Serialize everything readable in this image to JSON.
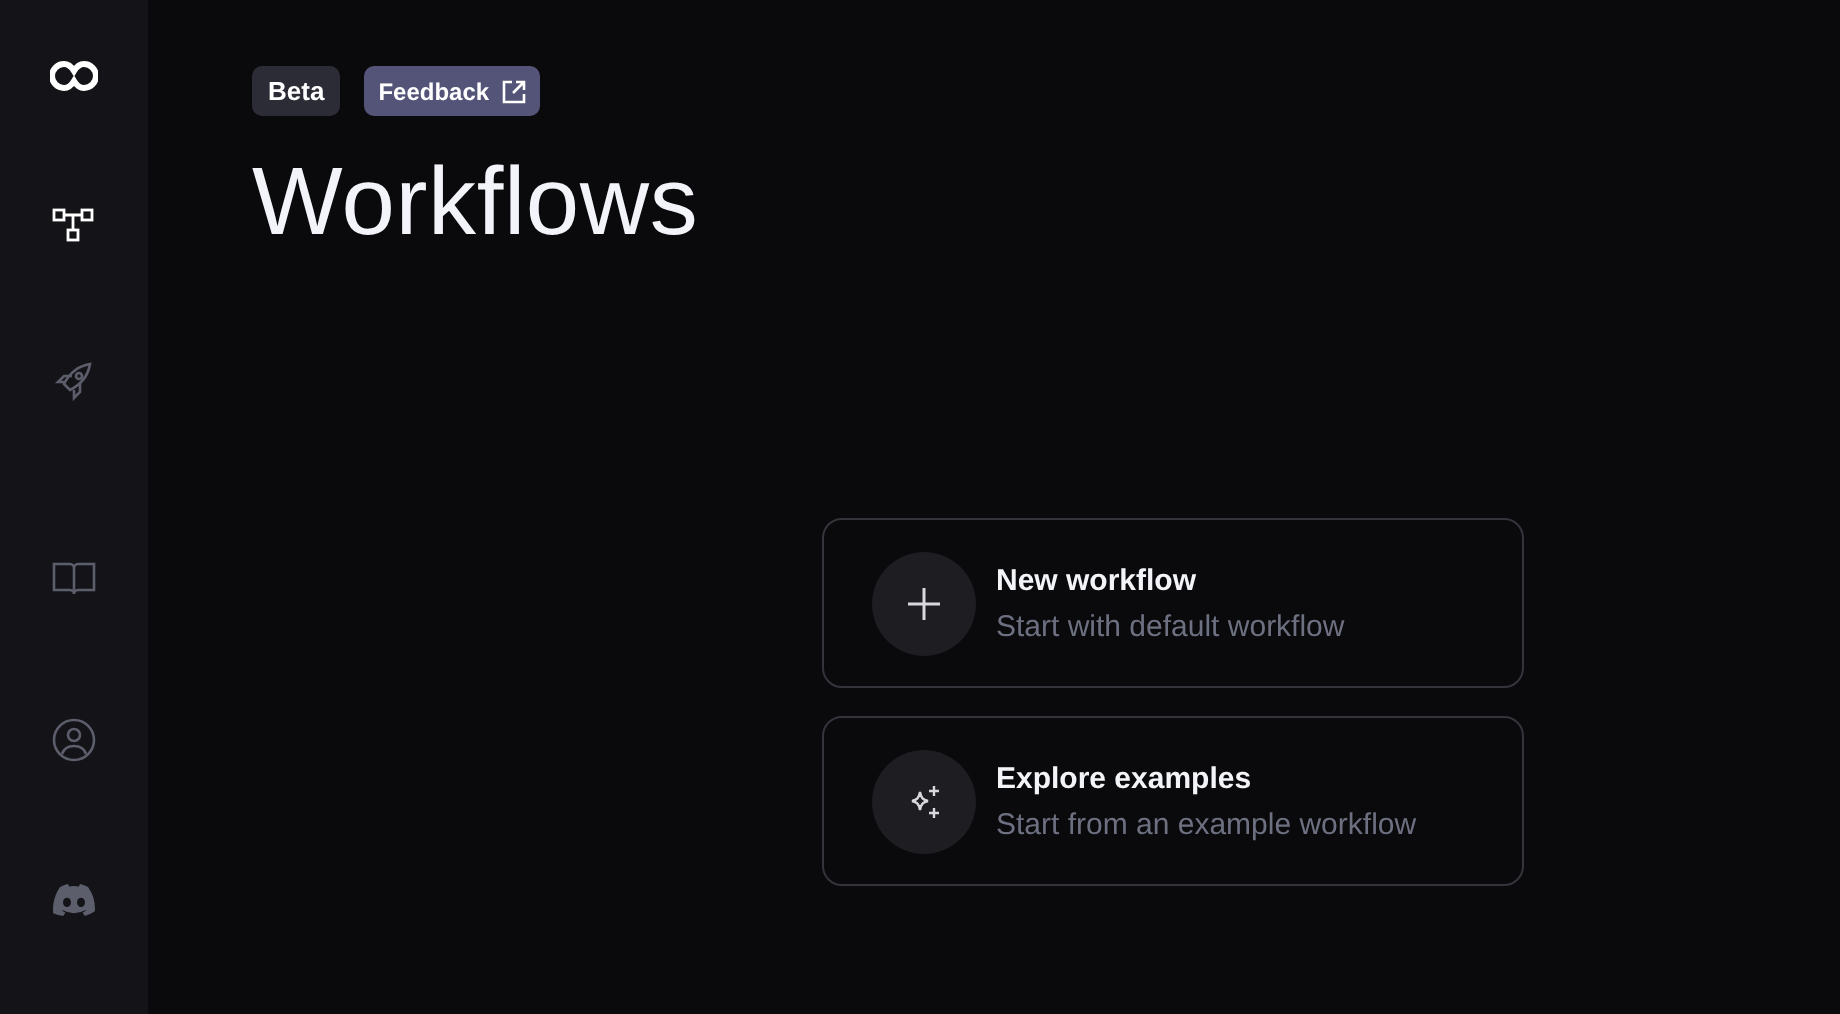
{
  "sidebar": {
    "items": [
      {
        "kind": "logo"
      },
      {
        "kind": "workflows",
        "selected": true
      },
      {
        "kind": "deploy",
        "selected": false
      },
      {
        "kind": "docs",
        "selected": false
      },
      {
        "kind": "account",
        "selected": false
      },
      {
        "kind": "discord",
        "selected": false
      }
    ]
  },
  "badges": [
    {
      "kind": "tag",
      "label": "Beta"
    },
    {
      "kind": "link",
      "label": "Feedback"
    }
  ],
  "title": "Workflows",
  "actions": [
    {
      "kind": "new",
      "title": "New workflow",
      "subtitle": "Start with default workflow"
    },
    {
      "kind": "examples",
      "title": "Explore examples",
      "subtitle": "Start from an example workflow"
    }
  ]
}
